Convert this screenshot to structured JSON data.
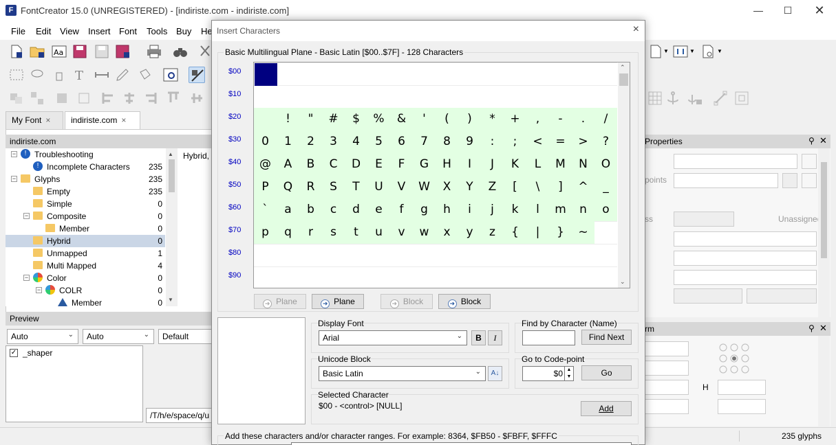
{
  "window": {
    "title": "FontCreator 15.0 (UNREGISTERED) - [indiriste.com - indiriste.com]",
    "app_icon": "F"
  },
  "menu": [
    "File",
    "Edit",
    "View",
    "Insert",
    "Font",
    "Tools",
    "Buy",
    "He"
  ],
  "tabs": [
    {
      "label": "My Font",
      "close": "×"
    },
    {
      "label": "indiriste.com",
      "close": "×"
    }
  ],
  "panel_left": {
    "title": "indiriste.com",
    "detail_text": "Hybrid,"
  },
  "tree": [
    {
      "label": "Troubleshooting",
      "count": ""
    },
    {
      "label": "Incomplete Characters",
      "count": "235"
    },
    {
      "label": "Glyphs",
      "count": "235"
    },
    {
      "label": "Empty",
      "count": "235"
    },
    {
      "label": "Simple",
      "count": "0"
    },
    {
      "label": "Composite",
      "count": "0"
    },
    {
      "label": "Member",
      "count": "0"
    },
    {
      "label": "Hybrid",
      "count": "0"
    },
    {
      "label": "Unmapped",
      "count": "1"
    },
    {
      "label": "Multi Mapped",
      "count": "4"
    },
    {
      "label": "Color",
      "count": "0"
    },
    {
      "label": "COLR",
      "count": "0"
    },
    {
      "label": "Member",
      "count": "0"
    }
  ],
  "preview": {
    "title": "Preview",
    "select1": "Auto",
    "select2": "Auto",
    "select3": "Default",
    "shaper_label": "_shaper",
    "path_text": "/T/h/e/space/q/u"
  },
  "properties": {
    "title": "Properties",
    "points_label": "points",
    "unassigned": "Unassigned",
    "ss_label": "ss"
  },
  "transform": {
    "title": "rm",
    "h_label": "H"
  },
  "status": {
    "glyphs": "235 glyphs"
  },
  "dialog": {
    "title": "Insert Characters",
    "close": "×",
    "block_header": "Basic Multilingual Plane - Basic Latin [$00..$7F] - 128 Characters",
    "row_labels": [
      "$00",
      "$10",
      "$20",
      "$30",
      "$40",
      "$50",
      "$60",
      "$70",
      "$80",
      "$90"
    ],
    "chars_row2": [
      " ",
      "!",
      "\"",
      "#",
      "$",
      "%",
      "&",
      "'",
      "(",
      ")",
      "*",
      "+",
      ",",
      "-",
      ".",
      "/"
    ],
    "chars_row3": [
      "0",
      "1",
      "2",
      "3",
      "4",
      "5",
      "6",
      "7",
      "8",
      "9",
      ":",
      ";",
      "<",
      "=",
      ">",
      "?"
    ],
    "chars_row4": [
      "@",
      "A",
      "B",
      "C",
      "D",
      "E",
      "F",
      "G",
      "H",
      "I",
      "J",
      "K",
      "L",
      "M",
      "N",
      "O"
    ],
    "chars_row5": [
      "P",
      "Q",
      "R",
      "S",
      "T",
      "U",
      "V",
      "W",
      "X",
      "Y",
      "Z",
      "[",
      "\\",
      "]",
      "^",
      "_"
    ],
    "chars_row6": [
      "`",
      "a",
      "b",
      "c",
      "d",
      "e",
      "f",
      "g",
      "h",
      "i",
      "j",
      "k",
      "l",
      "m",
      "n",
      "o"
    ],
    "chars_row7": [
      "p",
      "q",
      "r",
      "s",
      "t",
      "u",
      "v",
      "w",
      "x",
      "y",
      "z",
      "{",
      "|",
      "}",
      "~"
    ],
    "nav": {
      "prev_plane": "Plane",
      "next_plane": "Plane",
      "prev_block": "Block",
      "next_block": "Block"
    },
    "display_font": {
      "label": "Display Font",
      "value": "Arial",
      "bold": "B",
      "italic": "I"
    },
    "find": {
      "label": "Find by Character (Name)",
      "value": "",
      "button": "Find Next"
    },
    "unicode_block": {
      "label": "Unicode Block",
      "value": "Basic Latin"
    },
    "goto": {
      "label": "Go to Code-point",
      "value": "$0",
      "button": "Go"
    },
    "selected": {
      "label": "Selected Character",
      "value": "$00 - <control> [NULL]",
      "button": "Add"
    },
    "footer_text": "Add these characters and/or character ranges. For example: 8364, $FB50 - $FBFF, $FFFC"
  }
}
